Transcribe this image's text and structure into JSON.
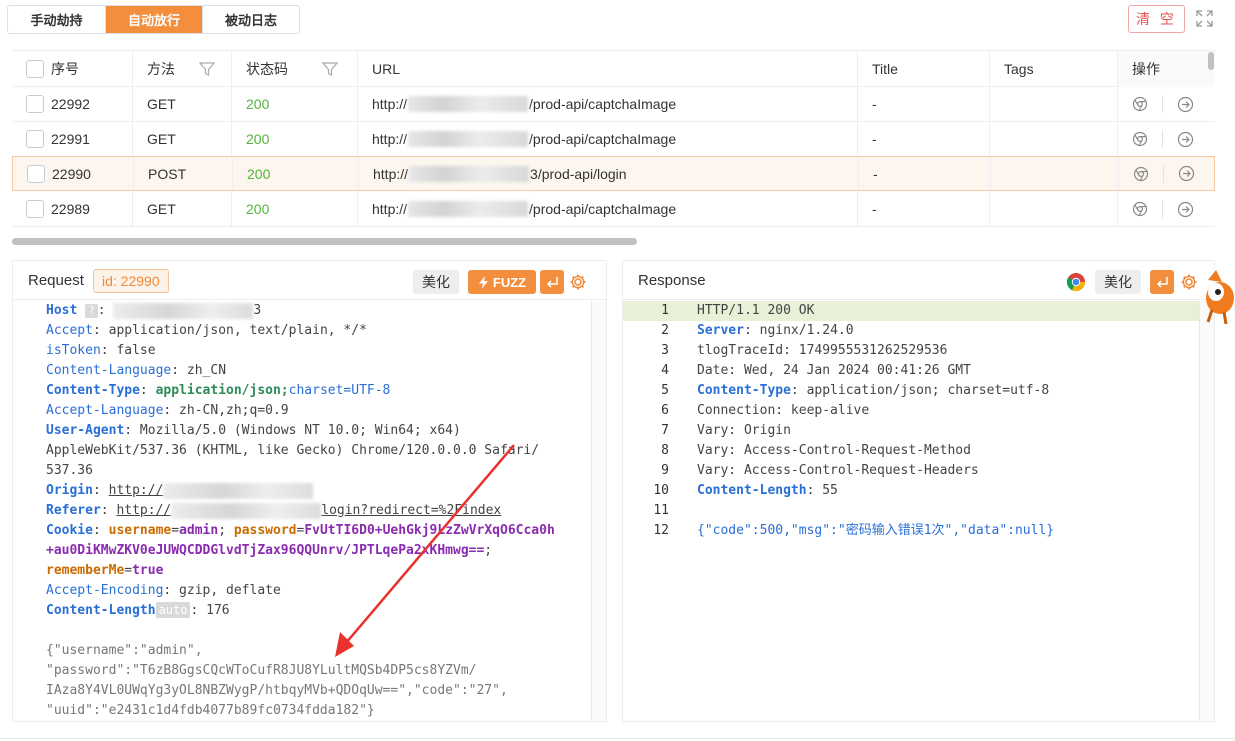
{
  "tabs": [
    {
      "label": "手动劫持",
      "active": false
    },
    {
      "label": "自动放行",
      "active": true
    },
    {
      "label": "被动日志",
      "active": false
    }
  ],
  "toolbar": {
    "clear_label": "清 空"
  },
  "table": {
    "headers": {
      "seq": "序号",
      "method": "方法",
      "status": "状态码",
      "url": "URL",
      "title": "Title",
      "tags": "Tags",
      "ops": "操作"
    },
    "rows": [
      {
        "seq": "22992",
        "method": "GET",
        "status": "200",
        "url_prefix": "http://",
        "url_suffix": "/prod-api/captchaImage",
        "title": "-",
        "tags": "",
        "selected": false
      },
      {
        "seq": "22991",
        "method": "GET",
        "status": "200",
        "url_prefix": "http://",
        "url_suffix": "/prod-api/captchaImage",
        "title": "-",
        "tags": "",
        "selected": false
      },
      {
        "seq": "22990",
        "method": "POST",
        "status": "200",
        "url_prefix": "http://",
        "url_suffix": "3/prod-api/login",
        "title": "-",
        "tags": "",
        "selected": true
      },
      {
        "seq": "22989",
        "method": "GET",
        "status": "200",
        "url_prefix": "http://",
        "url_suffix": "/prod-api/captchaImage",
        "title": "-",
        "tags": "",
        "selected": false
      }
    ]
  },
  "request": {
    "title": "Request",
    "id_badge": "id: 22990",
    "beautify_label": "美化",
    "fuzz_label": "FUZZ",
    "lines": {
      "host_key": "Host",
      "host_q": "?",
      "host_val": "3",
      "accept_key": "Accept",
      "accept_val": " application/json, text/plain, */*",
      "istoken_key": "isToken",
      "istoken_val": " false",
      "cl_key": "Content-Language",
      "cl_val": " zh_CN",
      "ct_key": "Content-Type",
      "ct_val1": " application/json;",
      "ct_val2": "charset=UTF-8",
      "al_key": "Accept-Language",
      "al_val": " zh-CN,zh;q=0.9",
      "ua_key": "User-Agent",
      "ua_val1": " Mozilla/5.0 (Windows NT 10.0; Win64; x64)",
      "ua_val2": "AppleWebKit/537.36 (KHTML, like Gecko) Chrome/120.0.0.0 Safari/",
      "ua_val3": "537.36",
      "origin_key": "Origin",
      "origin_val": "http://",
      "referer_key": "Referer",
      "referer_val1": "http://",
      "referer_val2": "login?redirect=%2Findex",
      "cookie_key": "Cookie",
      "cookie_u_key": "username",
      "cookie_u_val": "admin",
      "cookie_p_key": "password",
      "cookie_p_val1": "FvUtTI6D0+UehGkj9LzZwVrXqO6Cca0h",
      "cookie_p_val2": "+au0DiKMwZKV0eJUWQCDDGlvdTjZax96QQUnrv/JPTLqePa2xKHmwg==",
      "cookie_rm_key": "rememberMe",
      "cookie_rm_val": "true",
      "ae_key": "Accept-Encoding",
      "ae_val": " gzip, deflate",
      "clen_key": "Content-Length",
      "clen_auto": "auto",
      "clen_val": " 176",
      "body1": "{\"username\":\"admin\",",
      "body2": "\"password\":\"T6zB8GgsCQcWToCufR8JU8YLultMQSb4DP5cs8YZVm/",
      "body3": "IAza8Y4VL0UWqYg3yOL8NBZWygP/htbqyMVb+QDOqUw==\",\"code\":\"27\",",
      "body4": "\"uuid\":\"e2431c1d4fdb4077b89fc0734fdda182\"}"
    }
  },
  "response": {
    "title": "Response",
    "beautify_label": "美化",
    "lines": [
      {
        "n": "1",
        "text": "HTTP/1.1 200 OK"
      },
      {
        "n": "2",
        "key": "Server",
        "val": " nginx/1.24.0"
      },
      {
        "n": "3",
        "text": "tlogTraceId: 1749955531262529536"
      },
      {
        "n": "4",
        "text": "Date: Wed, 24 Jan 2024 00:41:26 GMT"
      },
      {
        "n": "5",
        "key": "Content-Type",
        "val": " application/json; charset=utf-8"
      },
      {
        "n": "6",
        "text": "Connection: keep-alive"
      },
      {
        "n": "7",
        "text": "Vary: Origin"
      },
      {
        "n": "8",
        "text": "Vary: Access-Control-Request-Method"
      },
      {
        "n": "9",
        "text": "Vary: Access-Control-Request-Headers"
      },
      {
        "n": "10",
        "key": "Content-Length",
        "val": " 55"
      },
      {
        "n": "11",
        "text": ""
      },
      {
        "n": "12",
        "text": "{\"code\":500,\"msg\":\"密码输入错误1次\",\"data\":null}"
      }
    ]
  }
}
